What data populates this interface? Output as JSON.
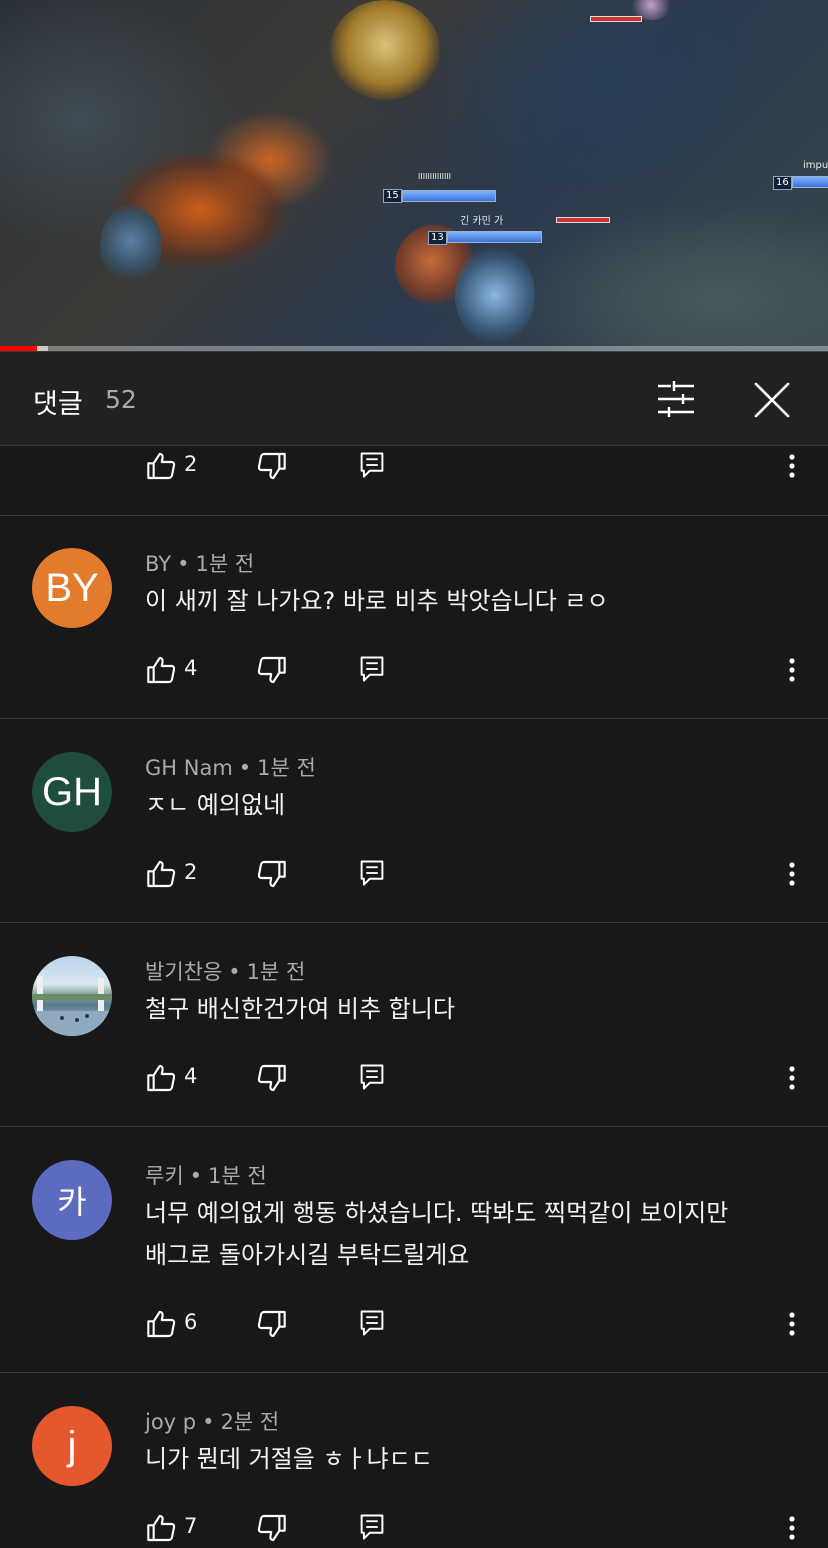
{
  "video": {
    "progress_fraction": 0.045,
    "overlay_texts": [
      "IIIIIIIIIIIIII",
      "긴 카민 가",
      "impu"
    ],
    "level_badges": [
      "15",
      "13",
      "16"
    ]
  },
  "header": {
    "title": "댓글",
    "count": "52"
  },
  "partial_top": {
    "likes": "2"
  },
  "comments": [
    {
      "avatar_letter": "BY",
      "avatar_color": "#e37b2c",
      "author": "BY",
      "time": "1분 전",
      "lines": [
        "이 새끼 잘 나가요? 바로 비추 박앗습니다 ㄹㅇ"
      ],
      "likes": "4"
    },
    {
      "avatar_letter": "GH",
      "avatar_color": "#1f4d3f",
      "author": "GH Nam",
      "time": "1분 전",
      "lines": [
        "ㅈㄴ 예의없네"
      ],
      "likes": "2"
    },
    {
      "avatar_letter": "",
      "avatar_color": "#8fb7d6",
      "author": "발기찬응",
      "time": "1분 전",
      "lines": [
        "철구 배신한건가여 비추 합니다"
      ],
      "likes": "4"
    },
    {
      "avatar_letter": "카",
      "avatar_color": "#5c6bc0",
      "author": "루키",
      "time": "1분 전",
      "lines": [
        "너무 예의없게 행동 하셨습니다. 딱봐도 찍먹같이 보이지만",
        "배그로 돌아가시길 부탁드릴게요"
      ],
      "likes": "6"
    },
    {
      "avatar_letter": "j",
      "avatar_color": "#e5582e",
      "author": "joy p",
      "time": "2분 전",
      "lines": [
        "니가 뭔데 거절을 ㅎㅏ냐ㄷㄷ"
      ],
      "likes": "7"
    }
  ],
  "colors": {
    "background": "#181818",
    "header_bg": "#212121",
    "divider": "#3a3a3a",
    "meta_text": "#aaaaaa",
    "progress": "#ff0000"
  },
  "icons": [
    "sort-icon",
    "close-icon",
    "thumb-up-icon",
    "thumb-down-icon",
    "reply-icon",
    "more-vert-icon"
  ]
}
